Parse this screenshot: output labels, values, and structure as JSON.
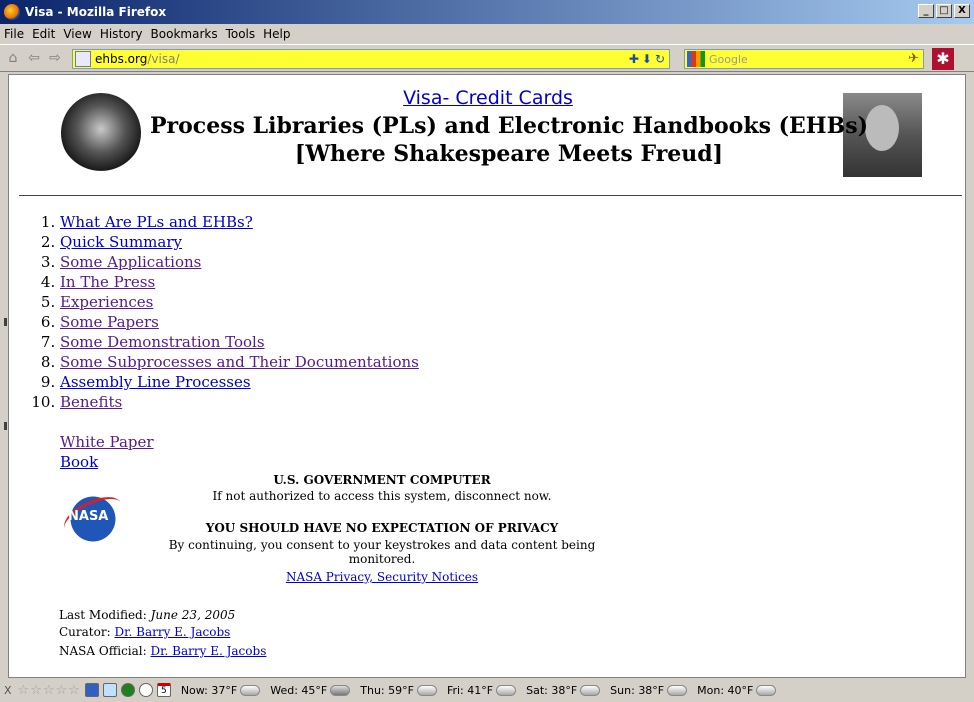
{
  "window": {
    "title": "Visa - Mozilla Firefox",
    "min": "_",
    "max": "□",
    "close": "X"
  },
  "menu": [
    "File",
    "Edit",
    "View",
    "History",
    "Bookmarks",
    "Tools",
    "Help"
  ],
  "toolbar": {
    "url_host": "ehbs.org",
    "url_path": "/visa/",
    "search_placeholder": "Google"
  },
  "page": {
    "title_link": "Visa- Credit Cards",
    "subtitle1": "Process Libraries (PLs) and Electronic Handbooks (EHBs)",
    "subtitle2": "[Where Shakespeare Meets Freud]",
    "toc": [
      "What Are PLs and EHBs?",
      "Quick Summary",
      "Some Applications",
      "In The Press",
      "Experiences",
      "Some Papers",
      "Some Demonstration Tools",
      "Some Subprocesses and Their Documentations",
      "Assembly Line Processes",
      "Benefits"
    ],
    "extra_links": [
      "White Paper",
      "Book"
    ],
    "gov_title": "U.S. GOVERNMENT COMPUTER",
    "gov_line1": "If not authorized to access this system, disconnect now.",
    "privacy_title": "YOU SHOULD HAVE NO EXPECTATION OF PRIVACY",
    "privacy_line": "By continuing, you consent to your keystrokes and data content being monitored.",
    "privacy_link": "NASA Privacy, Security Notices",
    "nasa_logo_text": "NASA",
    "last_modified_label": "Last Modified:",
    "last_modified_value": "June 23, 2005",
    "curator_label": "Curator:",
    "curator_name": "Dr. Barry E. Jacobs",
    "official_label": "NASA Official:",
    "official_name": "Dr. Barry E. Jacobs"
  },
  "status": {
    "close": "X",
    "calendar_day": "5",
    "weather": [
      {
        "day": "Now:",
        "temp": "37°F"
      },
      {
        "day": "Wed:",
        "temp": "45°F"
      },
      {
        "day": "Thu:",
        "temp": "59°F"
      },
      {
        "day": "Fri:",
        "temp": "41°F"
      },
      {
        "day": "Sat:",
        "temp": "38°F"
      },
      {
        "day": "Sun:",
        "temp": "38°F"
      },
      {
        "day": "Mon:",
        "temp": "40°F"
      }
    ]
  }
}
